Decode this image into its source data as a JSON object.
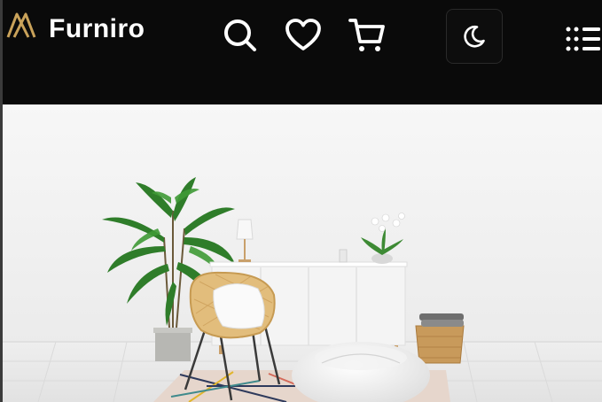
{
  "header": {
    "brand_name": "Furniro",
    "logo_icon": "furniro-logo-icon",
    "icons": {
      "search": "search-icon",
      "wishlist": "heart-icon",
      "cart": "cart-icon",
      "theme": "moon-icon",
      "menu": "menu-icon"
    }
  },
  "hero": {
    "image": "living-room-scene-image"
  },
  "colors": {
    "header_bg": "#0a0a0a",
    "logo_gold": "#c9a25a",
    "icon_white": "#ffffff",
    "room_wall": "#f1f1f1",
    "room_floor": "#e9e9e9"
  }
}
